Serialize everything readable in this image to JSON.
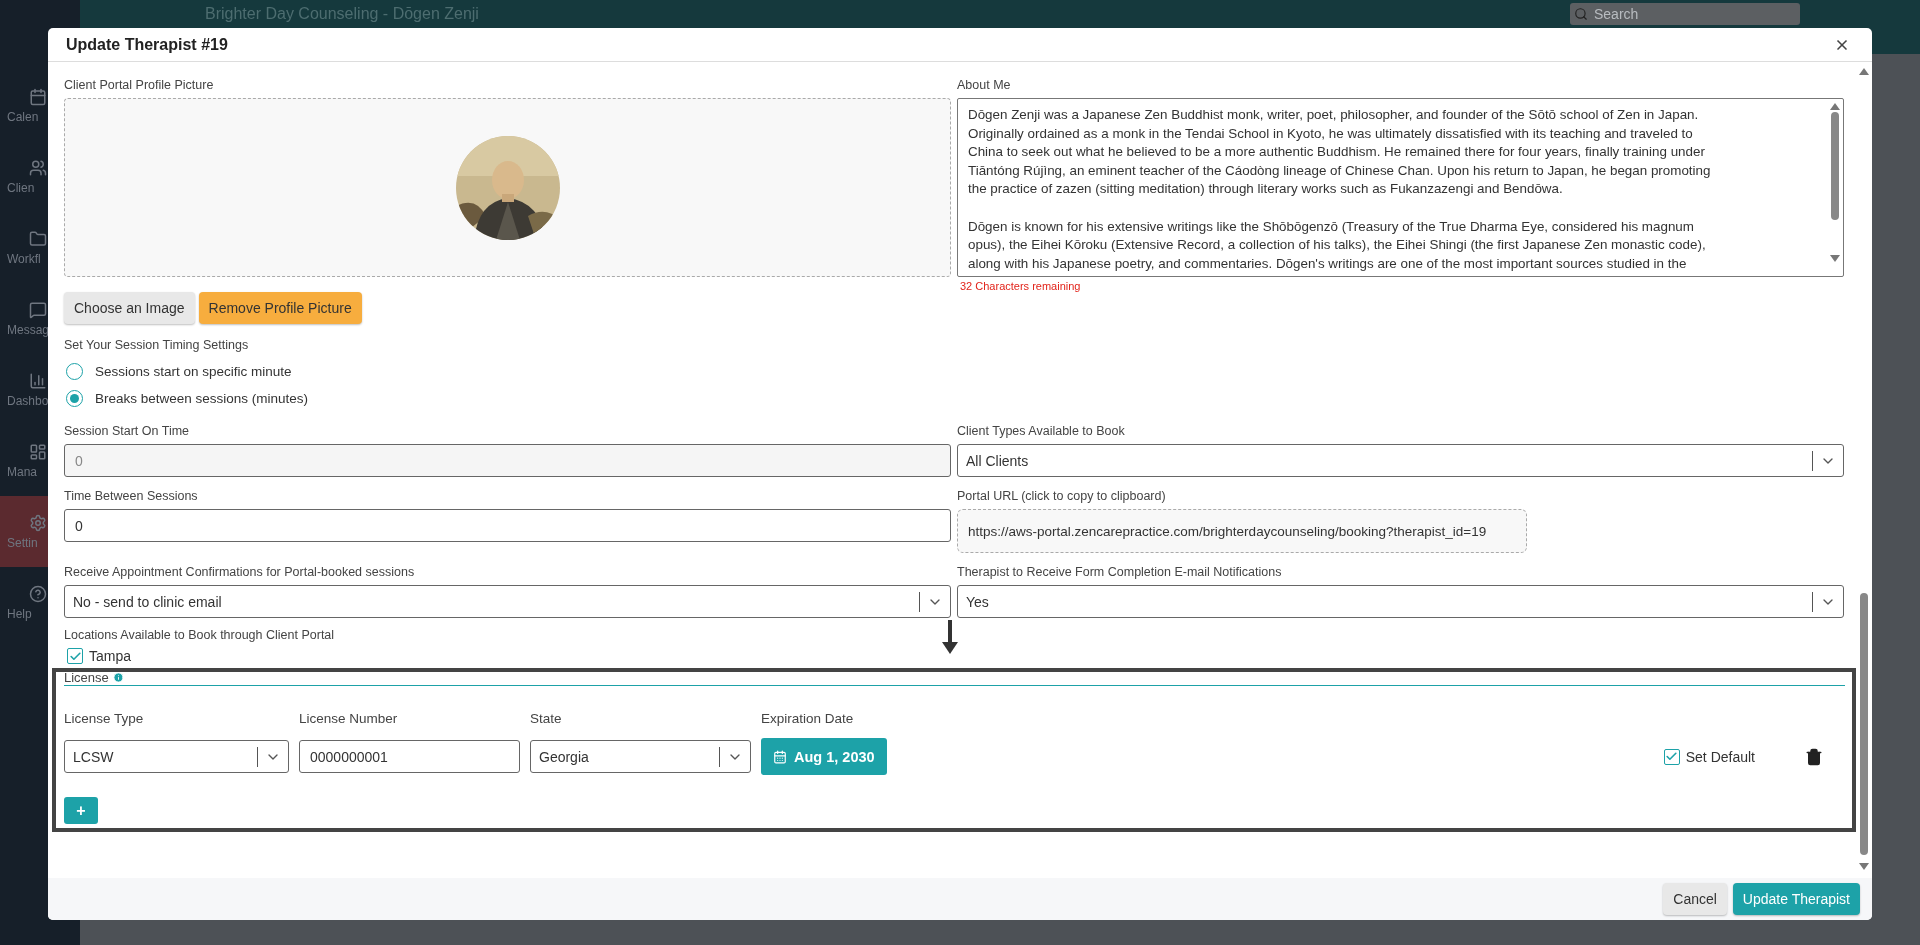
{
  "header": {
    "title": "Brighter Day Counseling - Dōgen Zenji",
    "search_placeholder": "Search"
  },
  "sidebar": {
    "items": [
      {
        "label": "Calen",
        "selected": false
      },
      {
        "label": "Clien",
        "selected": false
      },
      {
        "label": "Workfl",
        "selected": false
      },
      {
        "label": "Messag",
        "selected": false
      },
      {
        "label": "Dashbo",
        "selected": false
      },
      {
        "label": "Mana",
        "selected": false
      },
      {
        "label": "Settin",
        "selected": true
      },
      {
        "label": "Help",
        "selected": false
      }
    ]
  },
  "dialog": {
    "title": "Update Therapist #19",
    "profile_picture": {
      "label": "Client Portal Profile Picture",
      "buttons": [
        {
          "label": "Choose an Image",
          "kind": "secondary"
        },
        {
          "label": "Remove Profile Picture",
          "kind": "warning"
        }
      ]
    },
    "about_me": {
      "label": "About Me",
      "paragraphs": [
        [
          "Dōgen Zenji was a Japanese Zen Buddhist monk, writer, poet, philosopher, and founder of the Sōtō school of Zen in Japan.",
          "Originally ordained as a monk in the Tendai School in Kyoto, he was ultimately dissatisfied with its teaching and traveled to",
          "China to seek out what he believed to be a more authentic Buddhism. He remained there for four years, finally training under",
          "Tiāntóng Rújìng, an eminent teacher of the Cáodòng lineage of Chinese Chan. Upon his return to Japan, he began promoting",
          "the practice of zazen (sitting meditation) through literary works such as Fukanzazengi and Bendōwa."
        ],
        [
          "Dōgen is known for his extensive writings like the Shōbōgenzō (Treasury of the True Dharma Eye, considered his magnum",
          "opus), the Eihei Kōroku (Extensive Record, a collection of his talks), the Eihei Shingi (the first Japanese Zen monastic code),",
          "along with his Japanese poetry, and commentaries. Dōgen's writings are one of the most important sources studied in the"
        ]
      ],
      "hint": "32 Characters remaining"
    },
    "session_timing": {
      "label": "Set Your Session Timing Settings",
      "options": [
        {
          "label": "Sessions start on specific minute",
          "selected": false
        },
        {
          "label": "Breaks between sessions (minutes)",
          "selected": true
        }
      ]
    },
    "fields": [
      {
        "label": "Session Start On Time",
        "kind": "input",
        "value": "0",
        "disabled": true
      },
      {
        "label": "Client Types Available to Book",
        "kind": "select",
        "value": "All Clients"
      },
      {
        "label": "Time Between Sessions",
        "kind": "input",
        "value": "0",
        "disabled": false
      },
      {
        "label": "Portal URL (click to copy to clipboard)",
        "kind": "link",
        "value": "https://aws-portal.zencarepractice.com/brighterdaycounseling/booking?therapist_id=19"
      },
      {
        "label": "Receive Appointment Confirmations for Portal-booked sessions",
        "kind": "select",
        "value": "No - send to clinic email"
      },
      {
        "label": "Therapist to Receive Form Completion E-mail Notifications",
        "kind": "select",
        "value": "Yes"
      }
    ],
    "locations": {
      "label": "Locations Available to Book through Client Portal",
      "items": [
        {
          "label": "Tampa",
          "checked": true
        }
      ]
    },
    "license": {
      "title": "License",
      "columns": [
        "License Type",
        "License Number",
        "State",
        "Expiration Date"
      ],
      "rows": [
        {
          "license_type": "LCSW",
          "license_number": "0000000001",
          "state": "Georgia",
          "expiration_date": "Aug 1, 2030",
          "set_default": {
            "label": "Set Default",
            "checked": true
          }
        }
      ],
      "add_button": "+"
    },
    "footer_buttons": [
      {
        "label": "Cancel",
        "kind": "secondary"
      },
      {
        "label": "Update Therapist",
        "kind": "primary"
      }
    ]
  }
}
